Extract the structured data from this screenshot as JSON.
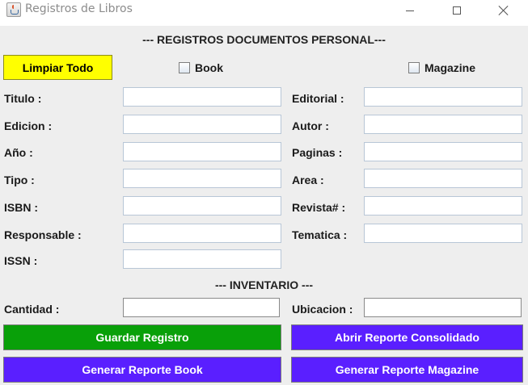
{
  "window": {
    "title": "Registros de Libros"
  },
  "header": {
    "main": "--- REGISTROS DOCUMENTOS PERSONAL---",
    "inventory": "--- INVENTARIO ---"
  },
  "toolbar": {
    "clear_all": "Limpiar Todo"
  },
  "options": {
    "book": "Book",
    "magazine": "Magazine"
  },
  "labels": {
    "titulo": "Titulo :",
    "edicion": "Edicion :",
    "anio": "Año :",
    "tipo": "Tipo :",
    "isbn": "ISBN :",
    "responsable": "Responsable :",
    "issn": "ISSN :",
    "editorial": "Editorial :",
    "autor": "Autor :",
    "paginas": "Paginas :",
    "area": "Area :",
    "revista": "Revista# :",
    "tematica": "Tematica :",
    "cantidad": "Cantidad :",
    "ubicacion": "Ubicacion :"
  },
  "buttons": {
    "guardar": "Guardar Registro",
    "abrir_reporte": "Abrir Reporte Consolidado",
    "reporte_book": "Generar Reporte Book",
    "reporte_magazine": "Generar Reporte Magazine"
  },
  "colors": {
    "clear_button": "#ffff00",
    "save_button": "#09a009",
    "report_button": "#5a1fff"
  }
}
